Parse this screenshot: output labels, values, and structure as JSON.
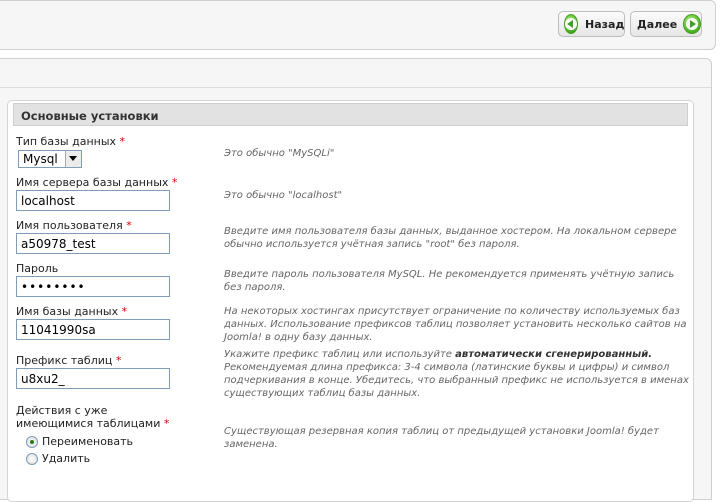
{
  "toolbar": {
    "back_label": "Назад",
    "next_label": "Далее"
  },
  "section": {
    "title": "Основные установки"
  },
  "fields": {
    "db_type": {
      "label": "Тип базы данных",
      "value": "Mysql",
      "hint": "Это обычно \"MySQLi\""
    },
    "host": {
      "label": "Имя сервера базы данных",
      "value": "localhost",
      "hint": "Это обычно \"localhost\""
    },
    "user": {
      "label": "Имя пользователя",
      "value": "a50978_test",
      "hint": "Введите имя пользователя базы данных, выданное хостером. На локальном сервере обычно используется учётная запись \"root\" без пароля."
    },
    "password": {
      "label": "Пароль",
      "value": "••••••••",
      "hint": "Введите пароль пользователя MySQL. Не рекомендуется применять учётную запись без пароля."
    },
    "db_name": {
      "label": "Имя базы данных",
      "value": "11041990sa",
      "hint": "На некоторых хостингах присутствует ограничение по количеству используемых баз данных. Использование префиксов таблиц позволяет установить несколько сайтов на Joomla! в одну базу данных."
    },
    "prefix": {
      "label": "Префикс таблиц",
      "value": "u8xu2_",
      "hint_pre": "Укажите префикс таблиц или используйте ",
      "hint_bold": "автоматически сгенерированный.",
      "hint_post": " Рекомендуемая длина префикса: 3-4 символа (латинские буквы и цифры) и символ подчеркивания в конце. Убедитесь, что выбранный префикс не используется в именах существующих таблиц базы данных."
    },
    "existing": {
      "label": "Действия с уже имеющимися таблицами",
      "hint": "Существующая резервная копия таблиц от предыдущей установки Joomla! будет заменена.",
      "options": [
        "Переименовать",
        "Удалить"
      ],
      "selected": "Переименовать"
    },
    "required_mark": "*"
  }
}
